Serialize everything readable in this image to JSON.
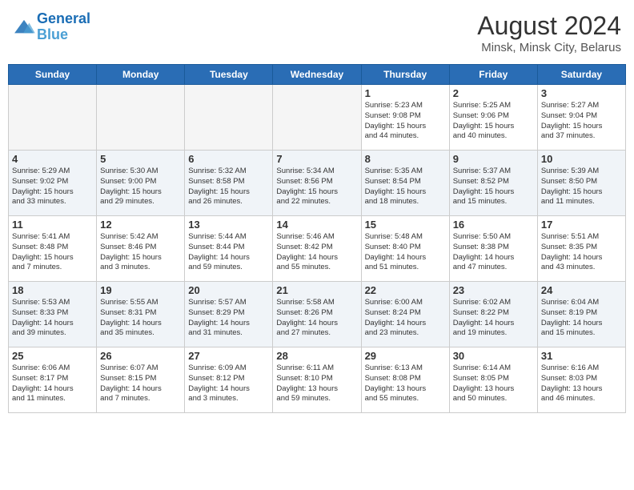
{
  "header": {
    "logo_line1": "General",
    "logo_line2": "Blue",
    "month_title": "August 2024",
    "location": "Minsk, Minsk City, Belarus"
  },
  "days_of_week": [
    "Sunday",
    "Monday",
    "Tuesday",
    "Wednesday",
    "Thursday",
    "Friday",
    "Saturday"
  ],
  "weeks": [
    {
      "days": [
        {
          "number": "",
          "info": ""
        },
        {
          "number": "",
          "info": ""
        },
        {
          "number": "",
          "info": ""
        },
        {
          "number": "",
          "info": ""
        },
        {
          "number": "1",
          "info": "Sunrise: 5:23 AM\nSunset: 9:08 PM\nDaylight: 15 hours\nand 44 minutes."
        },
        {
          "number": "2",
          "info": "Sunrise: 5:25 AM\nSunset: 9:06 PM\nDaylight: 15 hours\nand 40 minutes."
        },
        {
          "number": "3",
          "info": "Sunrise: 5:27 AM\nSunset: 9:04 PM\nDaylight: 15 hours\nand 37 minutes."
        }
      ]
    },
    {
      "days": [
        {
          "number": "4",
          "info": "Sunrise: 5:29 AM\nSunset: 9:02 PM\nDaylight: 15 hours\nand 33 minutes."
        },
        {
          "number": "5",
          "info": "Sunrise: 5:30 AM\nSunset: 9:00 PM\nDaylight: 15 hours\nand 29 minutes."
        },
        {
          "number": "6",
          "info": "Sunrise: 5:32 AM\nSunset: 8:58 PM\nDaylight: 15 hours\nand 26 minutes."
        },
        {
          "number": "7",
          "info": "Sunrise: 5:34 AM\nSunset: 8:56 PM\nDaylight: 15 hours\nand 22 minutes."
        },
        {
          "number": "8",
          "info": "Sunrise: 5:35 AM\nSunset: 8:54 PM\nDaylight: 15 hours\nand 18 minutes."
        },
        {
          "number": "9",
          "info": "Sunrise: 5:37 AM\nSunset: 8:52 PM\nDaylight: 15 hours\nand 15 minutes."
        },
        {
          "number": "10",
          "info": "Sunrise: 5:39 AM\nSunset: 8:50 PM\nDaylight: 15 hours\nand 11 minutes."
        }
      ]
    },
    {
      "days": [
        {
          "number": "11",
          "info": "Sunrise: 5:41 AM\nSunset: 8:48 PM\nDaylight: 15 hours\nand 7 minutes."
        },
        {
          "number": "12",
          "info": "Sunrise: 5:42 AM\nSunset: 8:46 PM\nDaylight: 15 hours\nand 3 minutes."
        },
        {
          "number": "13",
          "info": "Sunrise: 5:44 AM\nSunset: 8:44 PM\nDaylight: 14 hours\nand 59 minutes."
        },
        {
          "number": "14",
          "info": "Sunrise: 5:46 AM\nSunset: 8:42 PM\nDaylight: 14 hours\nand 55 minutes."
        },
        {
          "number": "15",
          "info": "Sunrise: 5:48 AM\nSunset: 8:40 PM\nDaylight: 14 hours\nand 51 minutes."
        },
        {
          "number": "16",
          "info": "Sunrise: 5:50 AM\nSunset: 8:38 PM\nDaylight: 14 hours\nand 47 minutes."
        },
        {
          "number": "17",
          "info": "Sunrise: 5:51 AM\nSunset: 8:35 PM\nDaylight: 14 hours\nand 43 minutes."
        }
      ]
    },
    {
      "days": [
        {
          "number": "18",
          "info": "Sunrise: 5:53 AM\nSunset: 8:33 PM\nDaylight: 14 hours\nand 39 minutes."
        },
        {
          "number": "19",
          "info": "Sunrise: 5:55 AM\nSunset: 8:31 PM\nDaylight: 14 hours\nand 35 minutes."
        },
        {
          "number": "20",
          "info": "Sunrise: 5:57 AM\nSunset: 8:29 PM\nDaylight: 14 hours\nand 31 minutes."
        },
        {
          "number": "21",
          "info": "Sunrise: 5:58 AM\nSunset: 8:26 PM\nDaylight: 14 hours\nand 27 minutes."
        },
        {
          "number": "22",
          "info": "Sunrise: 6:00 AM\nSunset: 8:24 PM\nDaylight: 14 hours\nand 23 minutes."
        },
        {
          "number": "23",
          "info": "Sunrise: 6:02 AM\nSunset: 8:22 PM\nDaylight: 14 hours\nand 19 minutes."
        },
        {
          "number": "24",
          "info": "Sunrise: 6:04 AM\nSunset: 8:19 PM\nDaylight: 14 hours\nand 15 minutes."
        }
      ]
    },
    {
      "days": [
        {
          "number": "25",
          "info": "Sunrise: 6:06 AM\nSunset: 8:17 PM\nDaylight: 14 hours\nand 11 minutes."
        },
        {
          "number": "26",
          "info": "Sunrise: 6:07 AM\nSunset: 8:15 PM\nDaylight: 14 hours\nand 7 minutes."
        },
        {
          "number": "27",
          "info": "Sunrise: 6:09 AM\nSunset: 8:12 PM\nDaylight: 14 hours\nand 3 minutes."
        },
        {
          "number": "28",
          "info": "Sunrise: 6:11 AM\nSunset: 8:10 PM\nDaylight: 13 hours\nand 59 minutes."
        },
        {
          "number": "29",
          "info": "Sunrise: 6:13 AM\nSunset: 8:08 PM\nDaylight: 13 hours\nand 55 minutes."
        },
        {
          "number": "30",
          "info": "Sunrise: 6:14 AM\nSunset: 8:05 PM\nDaylight: 13 hours\nand 50 minutes."
        },
        {
          "number": "31",
          "info": "Sunrise: 6:16 AM\nSunset: 8:03 PM\nDaylight: 13 hours\nand 46 minutes."
        }
      ]
    }
  ]
}
